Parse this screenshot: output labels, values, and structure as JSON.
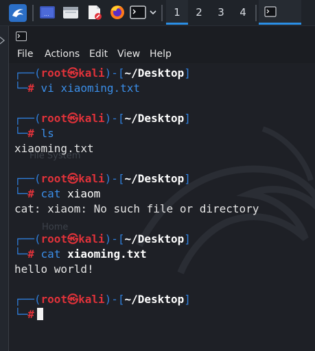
{
  "taskbar": {
    "workspaces": [
      "1",
      "2",
      "3",
      "4"
    ],
    "active_workspace": "1",
    "icons": [
      "kali-menu-icon",
      "desktop-icon",
      "file-manager-icon",
      "text-editor-icon",
      "firefox-icon",
      "terminal-icon"
    ]
  },
  "menu": {
    "file": "File",
    "actions": "Actions",
    "edit": "Edit",
    "view": "View",
    "help": "Help"
  },
  "wallpaper": {
    "ghost1": "File System",
    "ghost2": "Home"
  },
  "prompt": {
    "open_bracket": "┌──(",
    "user": "root",
    "at_symbol": "㉿",
    "host": "kali",
    "mid": ")-[",
    "path": "~/Desktop",
    "close": "]",
    "second_corner": "└─",
    "hash": "#"
  },
  "session": [
    {
      "command": "vi xiaoming.txt",
      "output": ""
    },
    {
      "command": "ls",
      "output": "xiaoming.txt"
    },
    {
      "command_prefix": "cat",
      "command_arg": "xiaom",
      "output": "cat: xiaom: No such file or directory"
    },
    {
      "command_prefix": "cat",
      "command_arg": "xiaoming.txt",
      "output": "hello world!"
    }
  ],
  "colors": {
    "prompt_blue": "#2f7fdc",
    "prompt_red": "#e0323a",
    "accent": "#2b8fe6",
    "background": "#1e2026"
  }
}
